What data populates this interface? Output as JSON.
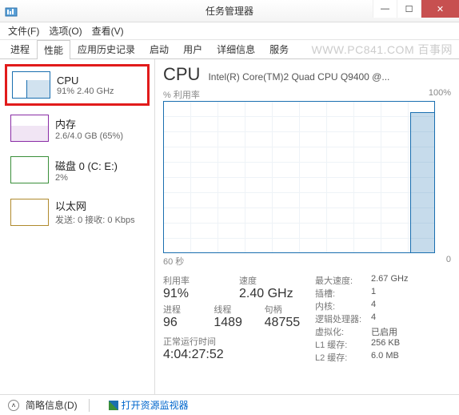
{
  "window": {
    "title": "任务管理器",
    "min": "—",
    "max": "☐",
    "close": "✕"
  },
  "menu": {
    "file": "文件(F)",
    "options": "选项(O)",
    "view": "查看(V)"
  },
  "tabs": [
    "进程",
    "性能",
    "应用历史记录",
    "启动",
    "用户",
    "详细信息",
    "服务"
  ],
  "watermark": "WWW.PC841.COM 百事网",
  "sidebar": {
    "items": [
      {
        "name": "CPU",
        "sub": "91% 2.40 GHz"
      },
      {
        "name": "内存",
        "sub": "2.6/4.0 GB (65%)"
      },
      {
        "name": "磁盘 0 (C: E:)",
        "sub": "2%"
      },
      {
        "name": "以太网",
        "sub": "发送: 0 接收: 0 Kbps"
      }
    ]
  },
  "main": {
    "title": "CPU",
    "desc": "Intel(R) Core(TM)2 Quad CPU Q9400 @...",
    "chart_top_left": "% 利用率",
    "chart_top_right": "100%",
    "chart_bot_left": "60 秒",
    "chart_bot_right": "0",
    "stats": {
      "util_lbl": "利用率",
      "util": "91%",
      "speed_lbl": "速度",
      "speed": "2.40 GHz",
      "proc_lbl": "进程",
      "proc": "96",
      "thr_lbl": "线程",
      "thr": "1489",
      "hnd_lbl": "句柄",
      "hnd": "48755",
      "uptime_lbl": "正常运行时间",
      "uptime": "4:04:27:52"
    },
    "right": {
      "maxspeed_k": "最大速度:",
      "maxspeed_v": "2.67 GHz",
      "sockets_k": "插槽:",
      "sockets_v": "1",
      "cores_k": "内核:",
      "cores_v": "4",
      "lproc_k": "逻辑处理器:",
      "lproc_v": "4",
      "virt_k": "虚拟化:",
      "virt_v": "已启用",
      "l1_k": "L1 缓存:",
      "l1_v": "256 KB",
      "l2_k": "L2 缓存:",
      "l2_v": "6.0 MB"
    }
  },
  "footer": {
    "brief": "简略信息(D)",
    "resmon": "打开资源监视器"
  },
  "chart_data": {
    "type": "line",
    "title": "% 利用率",
    "xlabel": "60 秒",
    "ylabel": "%",
    "ylim": [
      0,
      100
    ],
    "xlim": [
      60,
      0
    ],
    "series": [
      {
        "name": "CPU",
        "values": [
          0,
          0,
          0,
          0,
          0,
          0,
          0,
          0,
          0,
          0,
          0,
          0,
          0,
          0,
          0,
          0,
          0,
          0,
          0,
          0,
          0,
          0,
          0,
          0,
          0,
          0,
          0,
          0,
          0,
          0,
          0,
          0,
          0,
          0,
          0,
          0,
          0,
          0,
          0,
          0,
          0,
          0,
          0,
          0,
          0,
          0,
          0,
          0,
          0,
          0,
          0,
          0,
          0,
          0,
          0,
          88,
          92,
          90,
          91,
          91
        ]
      }
    ]
  }
}
